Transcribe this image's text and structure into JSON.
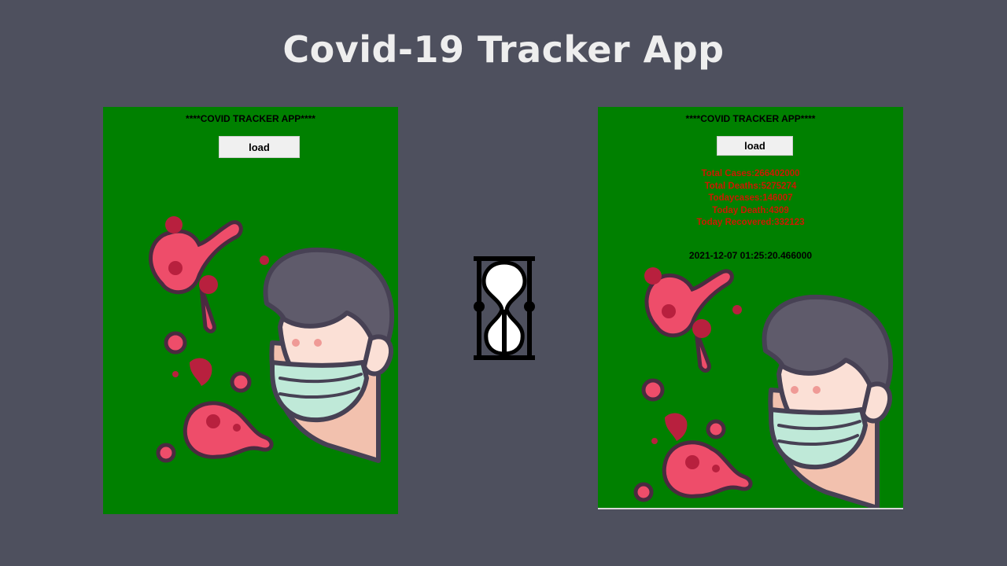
{
  "page": {
    "title": "Covid-19 Tracker App"
  },
  "left_window": {
    "heading": "****COVID TRACKER APP****",
    "load_label": "load",
    "illustration_icon": "masked-person-with-virus-icon"
  },
  "right_window": {
    "heading": "****COVID TRACKER APP****",
    "load_label": "load",
    "stats": {
      "total_cases": "Total Cases:266402000",
      "total_deaths": "Total Deaths:5275274",
      "today_cases": "Todaycases:146007",
      "today_death": "Today Death:4309",
      "today_recovered": "Today Recovered:332123"
    },
    "timestamp": "2021-12-07 01:25:20.466000",
    "illustration_icon": "masked-person-with-virus-icon"
  },
  "center": {
    "icon": "hourglass-icon"
  },
  "colors": {
    "background": "#4e505e",
    "window_bg": "#008000",
    "stats_text": "#cc1a00",
    "virus": "#ee4d6a",
    "virus_dark": "#b8203e"
  }
}
